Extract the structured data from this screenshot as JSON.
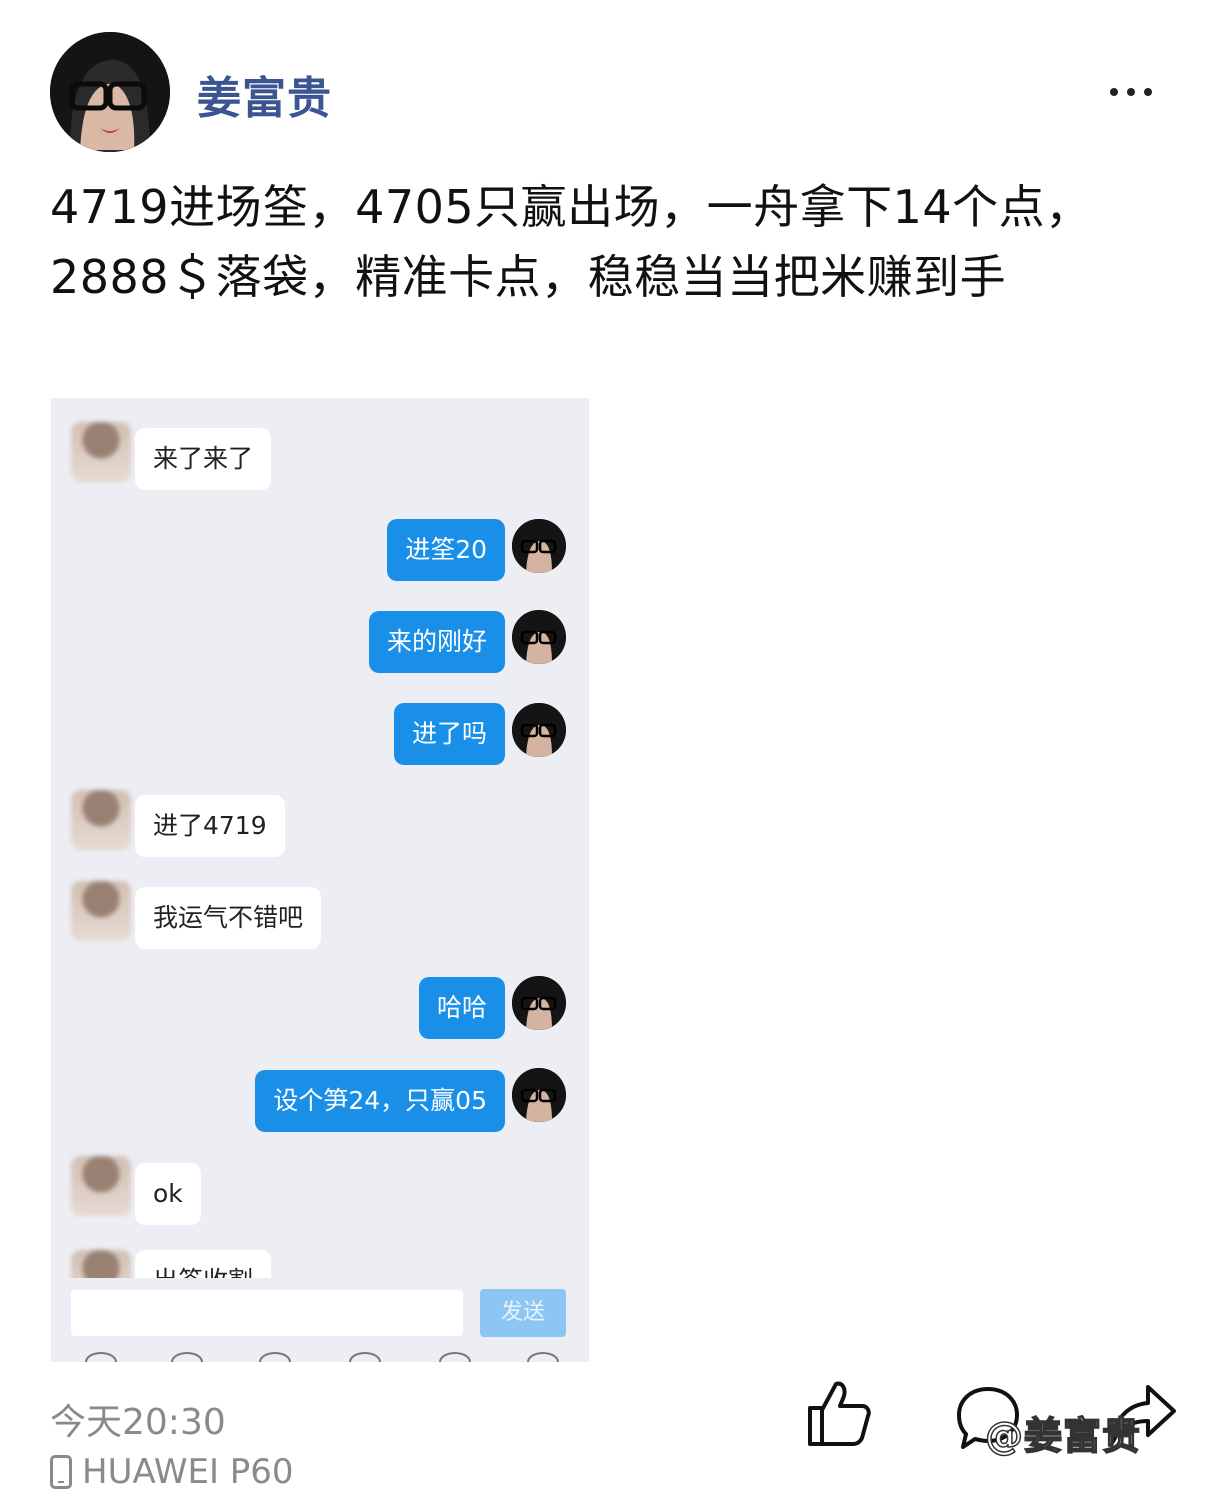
{
  "author": {
    "name": "姜富贵"
  },
  "post": {
    "text": "4719进场筌，4705只赢出场，一舟拿下14个点，2888＄落袋，精准卡点，稳稳当当把米赚到手"
  },
  "chat": {
    "messages": [
      {
        "side": "left",
        "text": "来了来了"
      },
      {
        "side": "right",
        "text": "进筌20"
      },
      {
        "side": "right",
        "text": "来的刚好"
      },
      {
        "side": "right",
        "text": "进了吗"
      },
      {
        "side": "left",
        "text": "进了4719"
      },
      {
        "side": "left",
        "text": "我运气不错吧"
      },
      {
        "side": "right",
        "text": "哈哈"
      },
      {
        "side": "right",
        "text": "设个笋24，只赢05"
      },
      {
        "side": "left",
        "text": "ok"
      },
      {
        "side": "left",
        "text": "出筌收割"
      }
    ],
    "send_label": "发送",
    "input_value": ""
  },
  "footer": {
    "time": "今天20:30",
    "device": "HUAWEI P60",
    "watermark": "@姜富贵"
  },
  "icons": {
    "more": "more-dots-icon",
    "like": "thumbs-up-icon",
    "comment": "comment-bubble-icon",
    "share": "share-arrow-icon",
    "device": "phone-icon"
  },
  "colors": {
    "author_name": "#3a5592",
    "sent_bubble": "#1a8fe8",
    "send_button": "#8cc6f2",
    "chat_bg": "#eceef3"
  }
}
